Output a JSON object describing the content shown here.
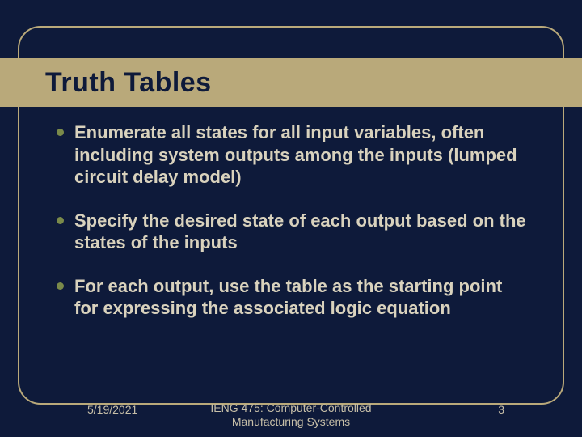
{
  "title": "Truth Tables",
  "bullets": [
    "Enumerate all states for all input variables, often including system outputs among the inputs (lumped circuit delay model)",
    "Specify the desired state of each output based on the states of the inputs",
    "For each output, use the table as the starting point for expressing the associated logic equation"
  ],
  "footer": {
    "date": "5/19/2021",
    "course": "IENG 475: Computer-Controlled Manufacturing Systems",
    "page": "3"
  }
}
